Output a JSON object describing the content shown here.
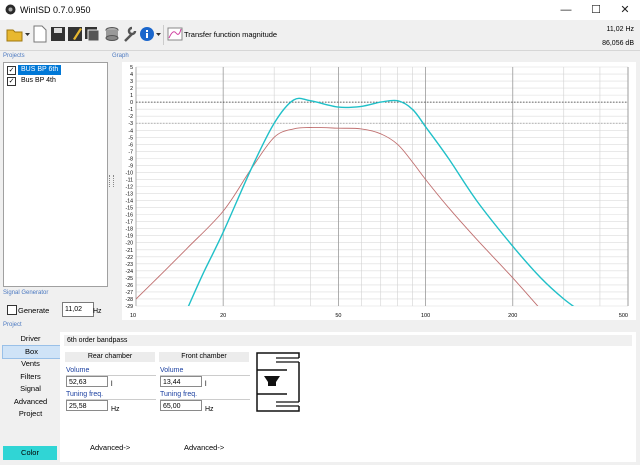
{
  "app": {
    "title": "WinISD 0.7.0.950"
  },
  "window_controls": {
    "minimize": "—",
    "maximize": "☐",
    "close": "✕"
  },
  "toolbar": {
    "view_label": "Transfer function magnitude",
    "freq_readout": "11,02 Hz",
    "db_readout": "86,056 dB"
  },
  "sections": {
    "projects": "Projects",
    "graph": "Graph",
    "signal_generator": "Signal Generator",
    "project": "Project"
  },
  "projects": [
    {
      "name": "BUS BP 6th",
      "checked": true,
      "selected": true
    },
    {
      "name": "Bus BP 4th",
      "checked": true,
      "selected": false
    }
  ],
  "generator": {
    "label": "Generate",
    "frequency": "11,02",
    "unit": "Hz"
  },
  "nav": [
    "Driver",
    "Box",
    "Vents",
    "Filters",
    "Signal",
    "Advanced",
    "Project"
  ],
  "nav_selected": "Box",
  "color_button": "Color",
  "colors": {
    "series_cyan": "#20c0c8",
    "series_red": "#c07070",
    "selection": "#0078d7",
    "color_button": "#30d5d5"
  },
  "box": {
    "title": "6th order bandpass",
    "rear": {
      "header": "Rear chamber",
      "volume_label": "Volume",
      "volume": "52,63",
      "volume_unit": "l",
      "tuning_label": "Tuning freq.",
      "tuning": "25,58",
      "tuning_unit": "Hz",
      "advanced": "Advanced->"
    },
    "front": {
      "header": "Front chamber",
      "volume_label": "Volume",
      "volume": "13,44",
      "volume_unit": "l",
      "tuning_label": "Tuning freq.",
      "tuning": "65,00",
      "tuning_unit": "Hz",
      "advanced": "Advanced->"
    }
  },
  "chart_data": {
    "type": "line",
    "xscale": "log",
    "xlim": [
      10,
      500
    ],
    "ylim": [
      -29,
      5
    ],
    "x_ticks": [
      10,
      20,
      50,
      100,
      200,
      500
    ],
    "y_ticks": [
      5,
      4,
      3,
      2,
      1,
      0,
      -1,
      -2,
      -3,
      -4,
      -5,
      -6,
      -7,
      -8,
      -9,
      -10,
      -11,
      -12,
      -13,
      -14,
      -15,
      -16,
      -17,
      -18,
      -19,
      -20,
      -21,
      -22,
      -23,
      -24,
      -25,
      -26,
      -27,
      -28,
      -29
    ],
    "grid": true,
    "reference_lines": [
      0,
      -3
    ],
    "series": [
      {
        "color": "#20c0c8",
        "x": [
          15,
          17,
          20,
          25,
          30,
          35,
          40,
          50,
          60,
          70,
          80,
          90,
          100,
          120,
          150,
          200,
          250,
          300,
          350
        ],
        "y": [
          -29.5,
          -24.5,
          -18.5,
          -9.5,
          -3.0,
          0.3,
          0.2,
          -0.7,
          -0.6,
          0.0,
          0.2,
          -1.0,
          -3.5,
          -8.0,
          -14.0,
          -20.5,
          -25.0,
          -28.0,
          -30.0
        ]
      },
      {
        "color": "#c07070",
        "x": [
          10,
          12,
          15,
          20,
          25,
          30,
          35,
          40,
          50,
          60,
          70,
          80,
          90,
          100,
          120,
          150,
          200,
          250
        ],
        "y": [
          -28.0,
          -24.8,
          -20.8,
          -15.5,
          -9.5,
          -5.0,
          -3.8,
          -3.6,
          -3.7,
          -3.8,
          -4.5,
          -6.0,
          -8.5,
          -11.0,
          -15.0,
          -19.5,
          -25.0,
          -29.5
        ]
      }
    ]
  }
}
